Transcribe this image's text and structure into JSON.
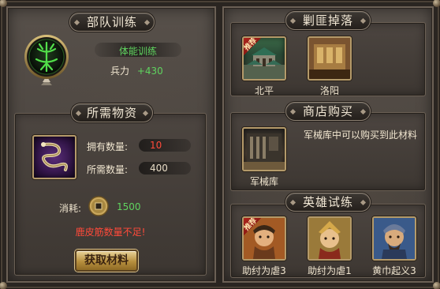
{
  "left": {
    "training": {
      "title": "部队训练",
      "name": "体能训练",
      "stat_label": "兵力",
      "stat_value": "+430"
    },
    "materials": {
      "title": "所需物资",
      "owned_label": "拥有数量:",
      "owned_value": "10",
      "required_label": "所需数量:",
      "required_value": "400",
      "cost_label": "消耗:",
      "cost_value": "1500",
      "warning": "鹿皮筋数量不足!",
      "get_button": "获取材料"
    }
  },
  "right": {
    "drops": {
      "title": "剿匪掉落",
      "items": [
        {
          "tag": "推荐",
          "label": "北平"
        },
        {
          "label": "洛阳"
        }
      ]
    },
    "shop": {
      "title": "商店购买",
      "item_label": "军械库",
      "description": "军械库中可以购买到此材料"
    },
    "heroes": {
      "title": "英雄试练",
      "items": [
        {
          "tag": "推荐",
          "label": "助纣为虐3"
        },
        {
          "label": "助纣为虐1"
        },
        {
          "label": "黄巾起义3"
        }
      ]
    }
  },
  "colors": {
    "green_text": "#5fd45f",
    "red_text": "#ff4a3a",
    "gold_border": "#b49a6a"
  }
}
